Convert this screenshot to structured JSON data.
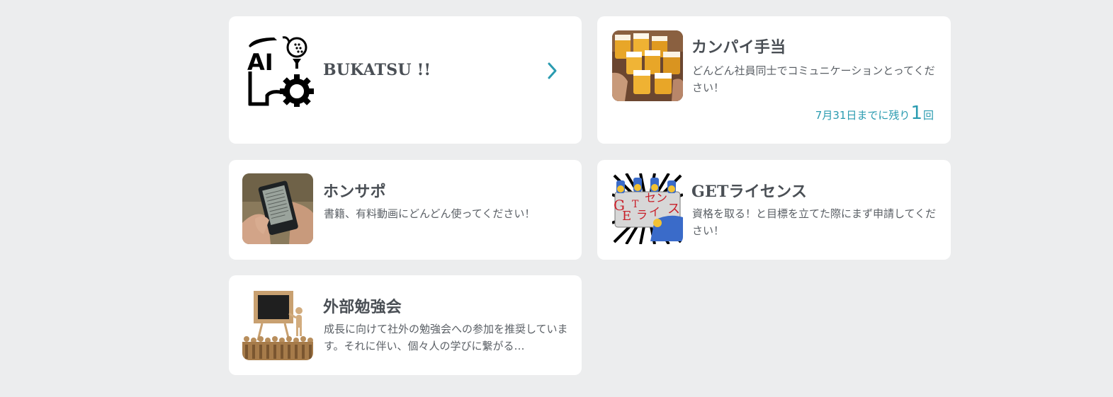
{
  "cards": [
    {
      "title": "BUKATSU !!",
      "icon": "bukatsu-ai-golf-gear-icon",
      "logo_text": "AI"
    },
    {
      "title": "カンパイ手当",
      "icon": "beer-toast-photo",
      "description": "どんどん社員同士でコミュニケーションとってください！",
      "quota": {
        "prefix": "7月31日までに残り",
        "count": "1",
        "suffix": "回"
      }
    },
    {
      "title": "ホンサポ",
      "icon": "ebook-reader-photo",
      "description": "書籍、有料動画にどんどん使ってください！"
    },
    {
      "title": "GETライセンス",
      "icon": "get-license-illustration",
      "description": "資格を取る！と目標を立てた際にまず申請してください！",
      "image_text": {
        "line1": "セン",
        "line2": "ス",
        "get1": "G",
        "get2": "E",
        "get3": "T",
        "ra": "ラ",
        "i": "イ"
      }
    },
    {
      "title": "外部勉強会",
      "icon": "seminar-blackboard-photo",
      "description": "成長に向けて社外の勉強会への参加を推奨しています。それに伴い、個々人の学びに繋がる…"
    }
  ],
  "colors": {
    "accent": "#2a9bb0",
    "background": "#ecedee",
    "card": "#ffffff",
    "title": "#4a4f55"
  }
}
